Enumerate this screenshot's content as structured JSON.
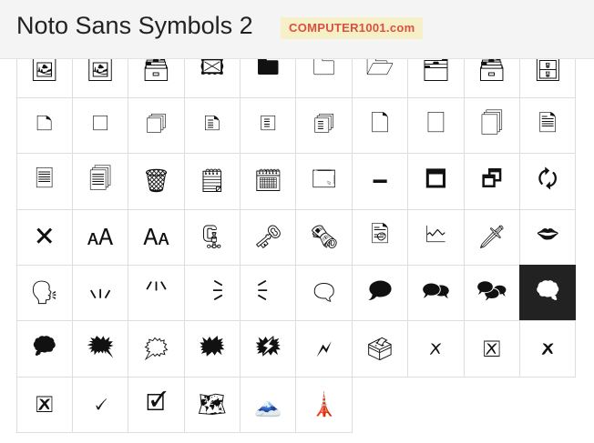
{
  "header": {
    "title": "Noto Sans Symbols 2",
    "badge": "COMPUTER1001.com"
  },
  "glyphs": [
    "🖼",
    "🖼",
    "🗃",
    "🖾",
    "🖿",
    "🗀",
    "🗁",
    "🗂",
    "🗃",
    "🗄",
    "🗅",
    "🗆",
    "🗇",
    "🗈",
    "🗉",
    "🗊",
    "🗋",
    "🗌",
    "🗍",
    "🗎",
    "🗏",
    "🗐",
    "🗑",
    "🗒",
    "🗓",
    "🗔",
    "🗕",
    "🗖",
    "🗗",
    "🗘",
    "🗙",
    "🗚",
    "🗛",
    "🗜",
    "🗝",
    "🗞",
    "🗟",
    "🗠",
    "🗡",
    "🗢",
    "🗣",
    "🗤",
    "🗥",
    "🗦",
    "🗧",
    "🗨",
    "🗩",
    "🗪",
    "🗫",
    "🗬",
    "🗭",
    "🗮",
    "🗯",
    "🗰",
    "🗱",
    "🗲",
    "🗳",
    "🗴",
    "🗵",
    "🗶",
    "🗷",
    "🗸",
    "🗹",
    "🗺",
    "🗻",
    "🗼"
  ],
  "selected_index": 49
}
